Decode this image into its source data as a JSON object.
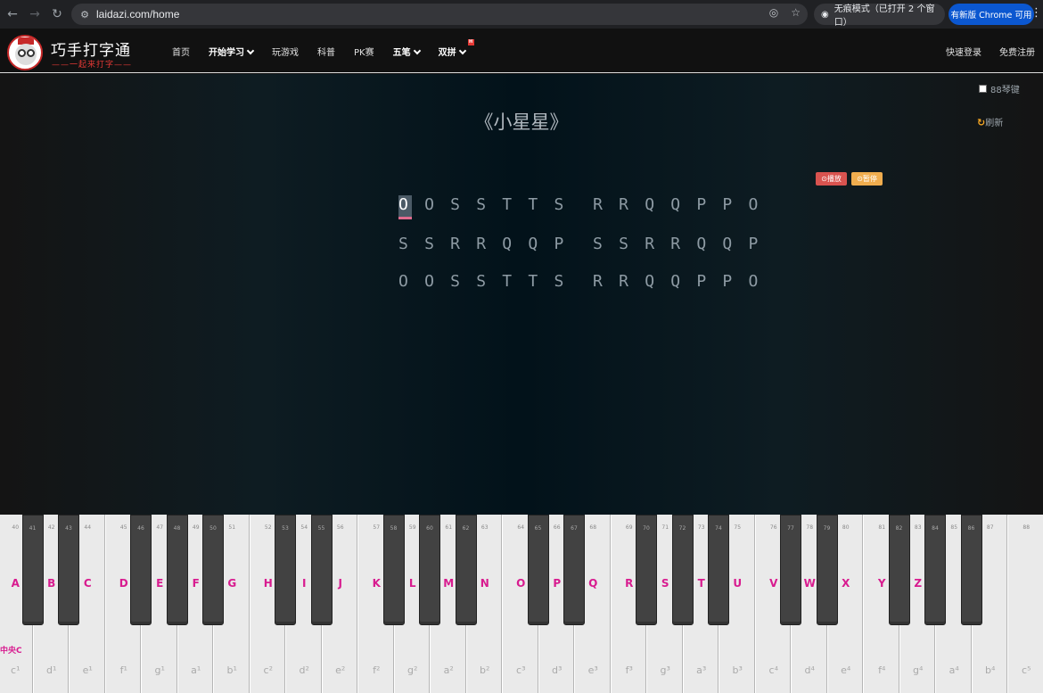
{
  "browser": {
    "url": "laidazi.com/home",
    "incognito_label": "无痕模式（已打开 2 个窗口）",
    "update_label": "有新版 Chrome 可用"
  },
  "header": {
    "brand": "巧手打字通",
    "tagline": "——一起来打字——",
    "nav": [
      "首页",
      "开始学习",
      "玩游戏",
      "科普",
      "PK赛",
      "五笔",
      "双拼"
    ],
    "hot_badge": "H",
    "login": "快速登录",
    "register": "免费注册"
  },
  "stage": {
    "title": "《小星星》",
    "opt_88": "88琴键",
    "refresh": "刷新",
    "play": "播放",
    "pause": "暂停",
    "cursor_char": "O",
    "line1_rest": " O S S T T S  R R Q Q P P O",
    "line2": "S S R R Q Q P  S S R R Q Q P",
    "line3": "O O S S T T S  R R Q Q P P O"
  },
  "piano": {
    "middle_c": "中央C",
    "white_numbers": [
      "40",
      "42",
      "44",
      "45",
      "47",
      "49",
      "51",
      "52",
      "54",
      "56",
      "57",
      "59",
      "61",
      "63",
      "64",
      "66",
      "68",
      "69",
      "71",
      "73",
      "75",
      "76",
      "78",
      "80",
      "81",
      "83",
      "85",
      "87",
      "88"
    ],
    "black_numbers": [
      "41",
      "43",
      "46",
      "48",
      "50",
      "53",
      "55",
      "58",
      "60",
      "62",
      "65",
      "67",
      "70",
      "72",
      "74",
      "77",
      "79",
      "82",
      "84",
      "86"
    ],
    "letters": [
      "A",
      "B",
      "C",
      "D",
      "E",
      "F",
      "G",
      "H",
      "I",
      "J",
      "K",
      "L",
      "M",
      "N",
      "O",
      "P",
      "Q",
      "R",
      "S",
      "T",
      "U",
      "V",
      "W",
      "X",
      "Y",
      "Z"
    ],
    "names": [
      "c¹",
      "d¹",
      "e¹",
      "f¹",
      "g¹",
      "a¹",
      "b¹",
      "c²",
      "d²",
      "e²",
      "f²",
      "g²",
      "a²",
      "b²",
      "c³",
      "d³",
      "e³",
      "f³",
      "g³",
      "a³",
      "b³",
      "c⁴",
      "d⁴",
      "e⁴",
      "f⁴",
      "g⁴",
      "a⁴",
      "b⁴",
      "c⁵"
    ]
  }
}
